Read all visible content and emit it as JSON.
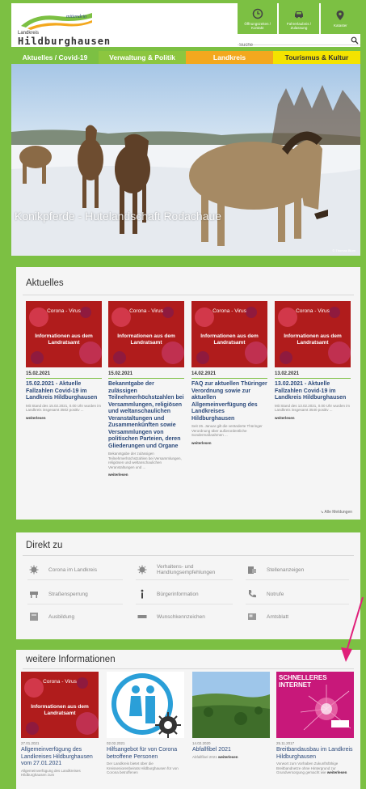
{
  "header": {
    "logo_script": "mittendrin",
    "logo_small": "Landkreis",
    "logo_big": "Hildburghausen",
    "quick_links": [
      {
        "label": "Öffnungszeiten / Kontakt",
        "icon": "clock-icon"
      },
      {
        "label": "Fahrerlaubnis / Zulassung",
        "icon": "car-icon"
      },
      {
        "label": "Kataster",
        "icon": "location-pin-icon"
      }
    ],
    "search_placeholder": "Suche"
  },
  "nav": [
    {
      "label": "Aktuelles / Covid-19",
      "color": "#7cc043"
    },
    {
      "label": "Verwaltung & Politik",
      "color": "#8cc63f"
    },
    {
      "label": "Landkreis",
      "color": "#f3a81e"
    },
    {
      "label": "Tourismus & Kultur",
      "color": "#f4e300"
    }
  ],
  "hero": {
    "caption": "Konikpferde - Hutelandschaft Rodachaue",
    "credit": "© Thomas Blum"
  },
  "aktuelles": {
    "title": "Aktuelles",
    "cards": [
      {
        "image_top": "Corona - Virus",
        "image_main": "Informationen aus dem Landratsamt",
        "date": "15.02.2021",
        "title": "15.02.2021 - Aktuelle Fallzahlen Covid-19 im Landkreis Hildburghausen",
        "text": "Mit Stand des 15.02.2021, 0.00 Uhr wurden im Landkreis insgesamt 3502 positiv ...",
        "more": "weiterlesen"
      },
      {
        "image_top": "Corona - Virus",
        "image_main": "Informationen aus dem Landratsamt",
        "date": "15.02.2021",
        "title": "Bekanntgabe der zulässigen Teilnehmerhöchstzahlen bei Versammlungen, religiösen und weltanschaulichen Veranstaltungen und Zusammenkünften sowie Versammlungen von politischen Parteien, deren Gliederungen und Organe",
        "text": "Bekanntgabe der zulässigen Teilnehmerhöchstzahlen bei Versammlungen, religiösen und weltanschaulichen Veranstaltungen und ...",
        "more": "weiterlesen"
      },
      {
        "image_top": "Corona - Virus",
        "image_main": "Informationen aus dem Landratsamt",
        "date": "14.02.2021",
        "title": "FAQ zur aktuellen Thüringer Verordnung sowie zur aktuellen Allgemeinverfügung des Landkreises Hildburghausen",
        "text": "Seit 26. Januar gilt die veränderte Thüringer Verordnung über außerordentliche Sondermaßnahmen ...",
        "more": "weiterlesen"
      },
      {
        "image_top": "Corona - Virus",
        "image_main": "Informationen aus dem Landratsamt",
        "date": "13.02.2021",
        "title": "13.02.2021 - Aktuelle Fallzahlen Covid-19 im Landkreis Hildburghausen",
        "text": "Mit Stand des 13.02.2021, 0.00 Uhr wurden im Landkreis insgesamt 3540 positiv ...",
        "more": "weiterlesen"
      }
    ],
    "all_link": "Alle Meldungen"
  },
  "direkt": {
    "title": "Direkt zu",
    "items": [
      {
        "label": "Corona im Landkreis",
        "icon": "virus-icon"
      },
      {
        "label": "Verhaltens- und Handlungsempfehlungen",
        "icon": "virus-icon"
      },
      {
        "label": "Stellenanzeigen",
        "icon": "job-icon"
      },
      {
        "label": "Straßensperrung",
        "icon": "roadblock-icon"
      },
      {
        "label": "Bürgerinformation",
        "icon": "info-icon"
      },
      {
        "label": "Notrufe",
        "icon": "phone-icon"
      },
      {
        "label": "Ausbildung",
        "icon": "education-icon"
      },
      {
        "label": "Wunschkennzeichen",
        "icon": "license-plate-icon"
      },
      {
        "label": "Amtsblatt",
        "icon": "newspaper-icon"
      }
    ]
  },
  "weitere": {
    "title": "weitere Informationen",
    "cards": [
      {
        "date": "27.01.2021",
        "title": "Allgemeinverfügung des Landkreises Hildburghausen vom 27.01.2021",
        "text": "Allgemeinverfügung des Landkreises Hildburghausen zum",
        "more": ""
      },
      {
        "date": "02.02.2021",
        "title": "Hilfsangebot für von Corona betroffene Personen",
        "text": "Der Landkreis bietet über die Kreisseniorenbeirats Hildburghausen für von Corona betroffenen",
        "more": ""
      },
      {
        "date": "14.02.2020",
        "title": "Abfallfibel 2021",
        "text": "Abfallfibel 2021",
        "more": "weiterlesen"
      },
      {
        "date": "25.11.2017",
        "title": "Breitbandausbau im Landkreis Hildburghausen",
        "text": "Vorwort zum Vorhaben Zukunftsfähige Breitbandnetze ohne Hintergrund zur Grundversorgung gemacht wie",
        "more": "weiterlesen"
      }
    ],
    "internet_text": "SCHNELLERES INTERNET"
  },
  "colors": {
    "accent": "#7cc043",
    "link": "#2c4a7b",
    "corona_red": "#b01c1c",
    "arrow": "#e0207a"
  }
}
